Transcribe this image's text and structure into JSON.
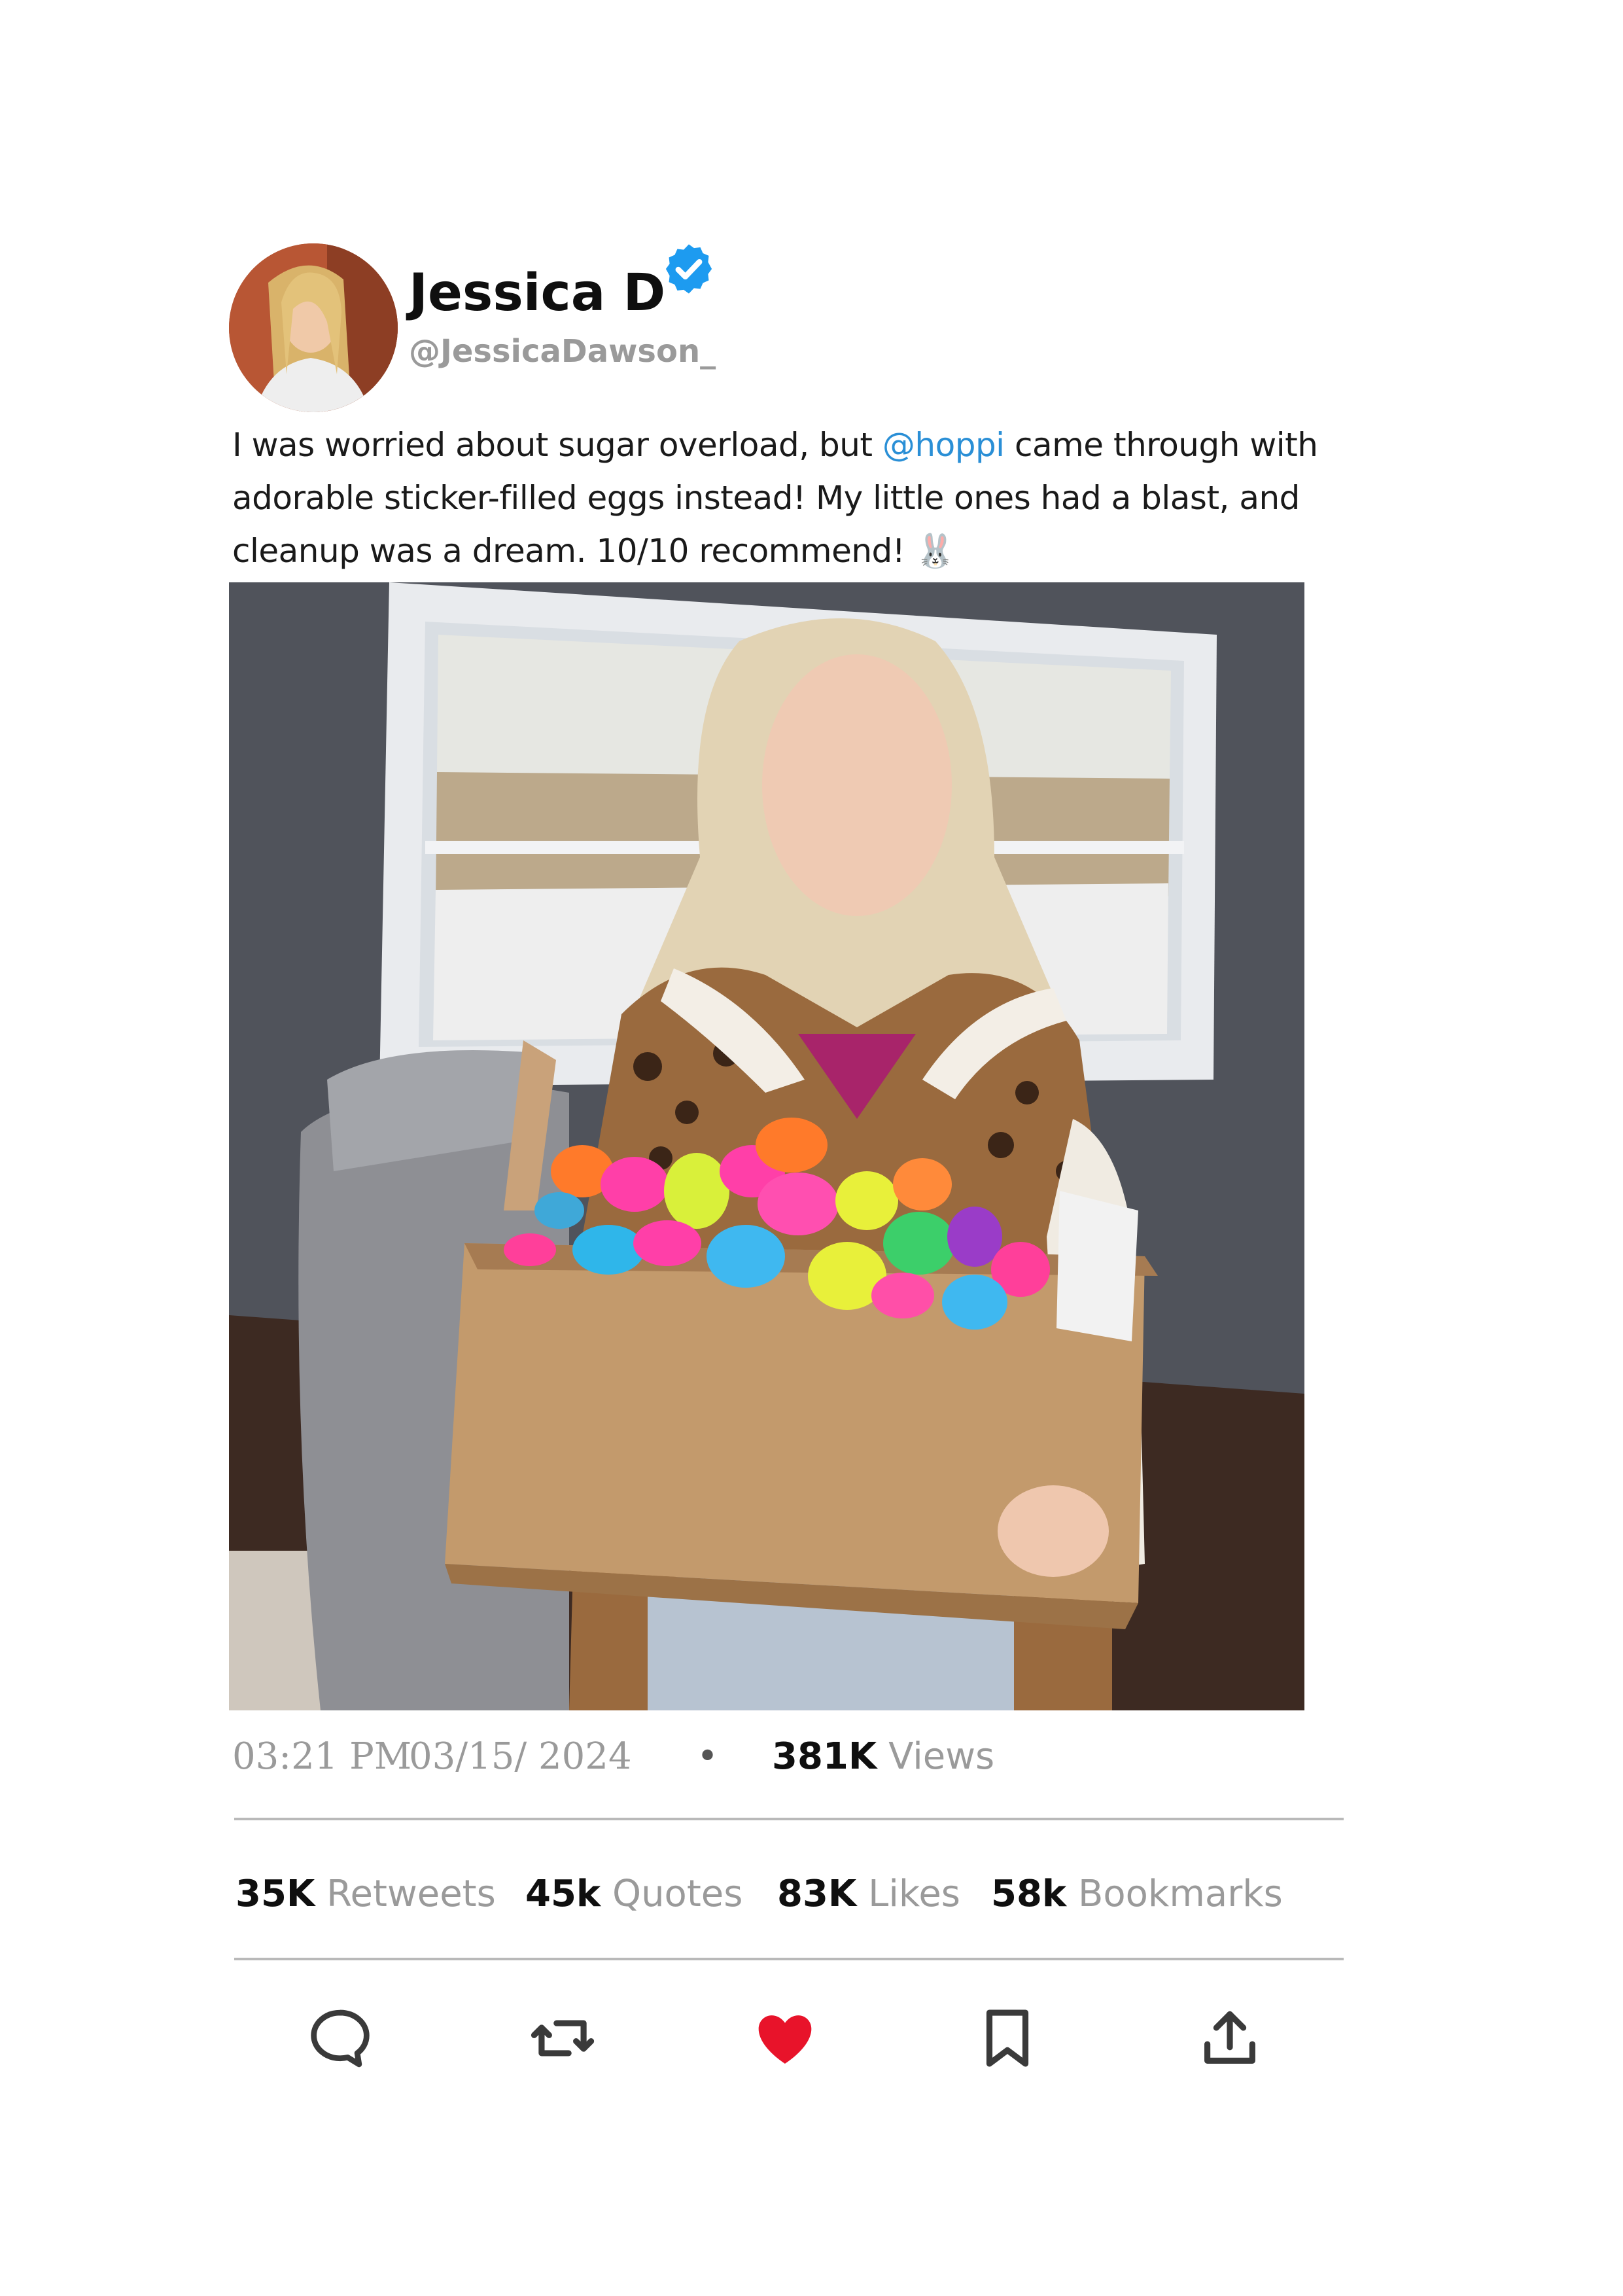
{
  "author": {
    "display_name": "Jessica D",
    "handle": "@JessicaDawson_",
    "verified": true
  },
  "tweet": {
    "text_before_mention": "I was worried about sugar overload, but ",
    "mention": "@hoppi",
    "text_after_mention": " came through with adorable sticker-filled eggs instead! My little ones had a blast, and cleanup was a dream. 10/10 recommend! ",
    "emoji": "🐰"
  },
  "meta": {
    "time": "03:21 PM",
    "date": "03/15/ 2024",
    "separator": "•",
    "views_count": "381K",
    "views_label": "Views"
  },
  "stats": {
    "retweets_count": "35K",
    "retweets_label": "Retweets",
    "quotes_count": "45k",
    "quotes_label": "Quotes",
    "likes_count": "83K",
    "likes_label": "Likes",
    "bookmarks_count": "58k",
    "bookmarks_label": "Bookmarks"
  },
  "actions": {
    "icons": [
      "reply-icon",
      "retweet-icon",
      "like-icon",
      "bookmark-icon",
      "share-icon"
    ],
    "like_active": true
  },
  "colors": {
    "mention": "#2a8fd6",
    "verified_badge": "#1d9bf0",
    "like_red": "#e8132a",
    "muted_text": "#9a9a9a",
    "divider": "#b9b9b9"
  }
}
